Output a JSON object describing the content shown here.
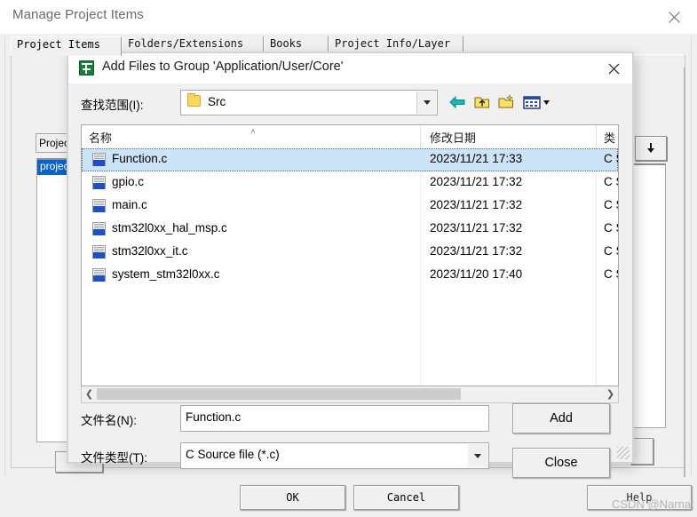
{
  "outer_window": {
    "title": "Manage Project Items",
    "close_icon": "close-icon",
    "tabs": [
      {
        "label": "Project Items",
        "active": true
      },
      {
        "label": "Folders/Extensions",
        "active": false
      },
      {
        "label": "Books",
        "active": false
      },
      {
        "label": "Project Info/Layer",
        "active": false
      }
    ],
    "projects_label": "Projec",
    "project_item": "projec",
    "buttons": {
      "ok": "OK",
      "cancel": "Cancel",
      "help": "Help"
    }
  },
  "watermark": "CSDN @Narnat",
  "dialog": {
    "title": "Add Files to Group 'Application/User/Core'",
    "app_icon": "uvision-icon",
    "close_icon": "close-icon",
    "lookin": {
      "label": "查找范围(I):",
      "value": "Src",
      "folder_icon": "folder-icon",
      "dropdown_icon": "chevron-down-icon"
    },
    "toolbar": [
      {
        "name": "back-icon"
      },
      {
        "name": "up-folder-icon"
      },
      {
        "name": "new-folder-icon"
      },
      {
        "name": "views-icon"
      }
    ],
    "filelist": {
      "columns": [
        "名称",
        "修改日期",
        "类"
      ],
      "sort_indicator": "˄",
      "rows": [
        {
          "name": "Function.c",
          "date": "2023/11/21 17:33",
          "type": "C S",
          "selected": true
        },
        {
          "name": "gpio.c",
          "date": "2023/11/21 17:32",
          "type": "C S",
          "selected": false
        },
        {
          "name": "main.c",
          "date": "2023/11/21 17:32",
          "type": "C S",
          "selected": false
        },
        {
          "name": "stm32l0xx_hal_msp.c",
          "date": "2023/11/21 17:32",
          "type": "C S",
          "selected": false
        },
        {
          "name": "stm32l0xx_it.c",
          "date": "2023/11/21 17:32",
          "type": "C S",
          "selected": false
        },
        {
          "name": "system_stm32l0xx.c",
          "date": "2023/11/20 17:40",
          "type": "C S",
          "selected": false
        }
      ],
      "scroll_left_icon": "chevron-left-icon",
      "scroll_right_icon": "chevron-right-icon"
    },
    "filename": {
      "label": "文件名(N):",
      "value": "Function.c"
    },
    "filetype": {
      "label": "文件类型(T):",
      "value": "C Source file (*.c)",
      "dropdown_icon": "chevron-down-icon"
    },
    "buttons": {
      "add": "Add",
      "close": "Close"
    }
  },
  "colors": {
    "selection_blue": "#cce4f7",
    "list_select_blue": "#0a63c8",
    "window_bg": "#f0f0f0",
    "folder_yellow": "#ffd75e",
    "back_arrow_teal": "#00a0a0"
  }
}
